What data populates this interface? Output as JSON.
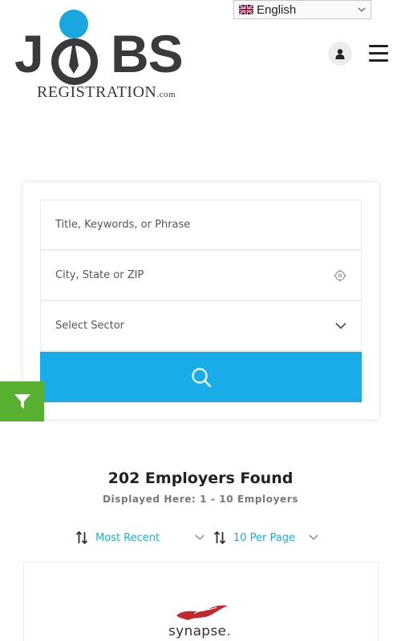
{
  "language": {
    "selected": "English"
  },
  "logo": {
    "letters_left": "J",
    "letters_right": "BS",
    "subtitle": "REGISTRATION",
    "subtitle_suffix": ".com"
  },
  "search": {
    "keywords_placeholder": "Title, Keywords, or Phrase",
    "location_placeholder": "City, State or ZIP",
    "sector_selected": "Select Sector"
  },
  "results": {
    "title": "202 Employers Found",
    "subtitle": "Displayed Here: 1 - 10 Employers",
    "sort_label": "Most Recent",
    "per_page_label": "10 Per Page"
  },
  "employer": {
    "name": "synapse",
    "dot": "."
  },
  "colors": {
    "accent": "#1aace8",
    "filter": "#57b030",
    "logo_blue": "#19a7e0",
    "dark": "#3a3a3a"
  },
  "icons": {
    "language": "uk-flag-icon",
    "user": "user-icon",
    "menu": "hamburger-icon",
    "location": "crosshair-icon",
    "sector": "chevron-down-icon",
    "search": "search-icon",
    "filter": "filter-icon",
    "sort": "sort-icon"
  }
}
